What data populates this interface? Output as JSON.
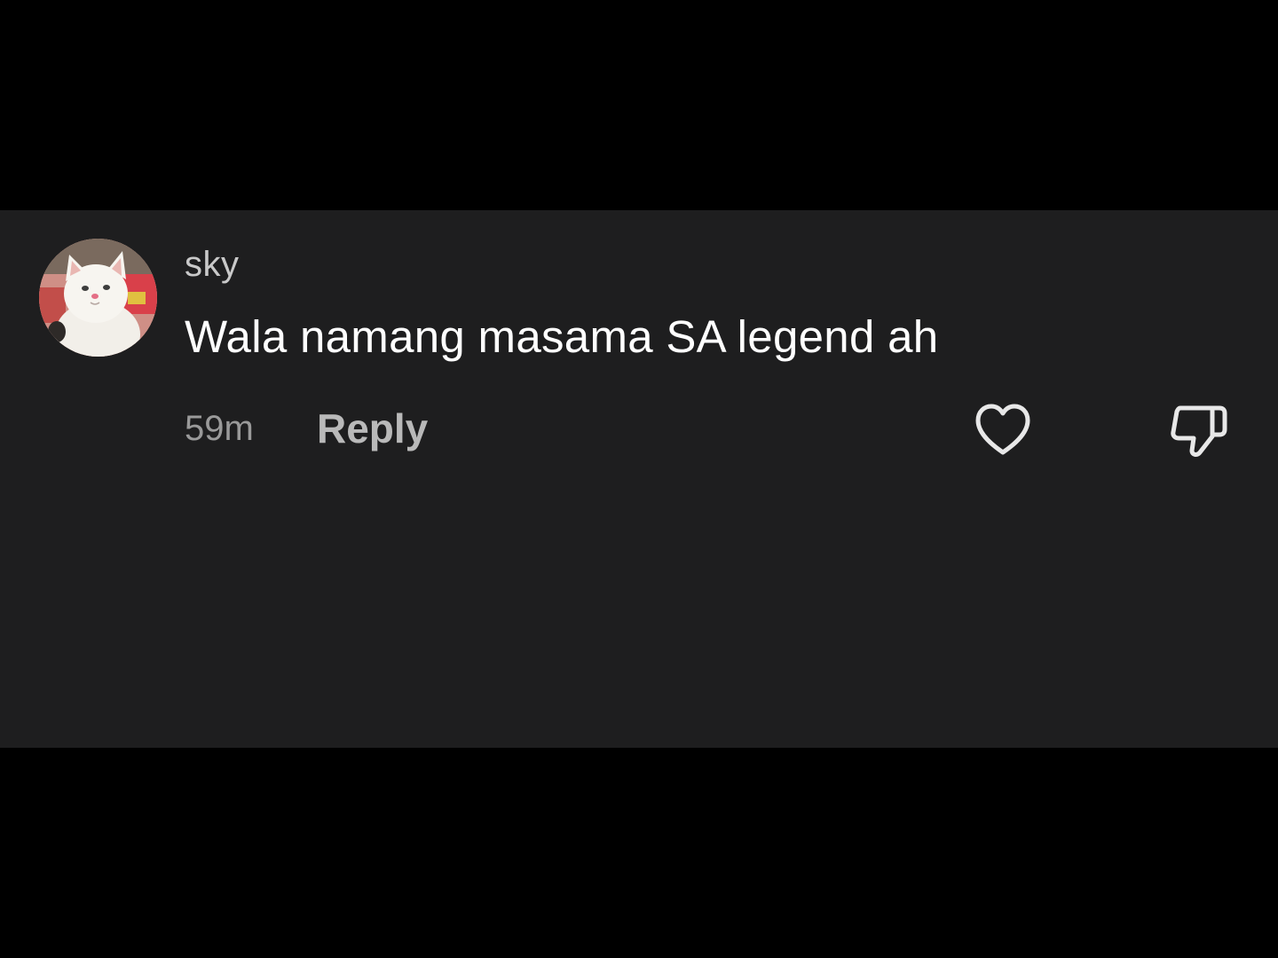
{
  "comment": {
    "username": "sky",
    "text": "Wala namang masama SA legend ah",
    "timestamp": "59m",
    "reply_label": "Reply",
    "avatar_icon": "cat-avatar",
    "like_icon": "heart-icon",
    "dislike_icon": "thumbs-down-icon"
  },
  "colors": {
    "background": "#000000",
    "panel": "#1e1e1f",
    "comment_text": "#ffffff",
    "username": "#c9c9c9",
    "timestamp": "#9a9a9a",
    "reply": "#b9b9b9"
  }
}
